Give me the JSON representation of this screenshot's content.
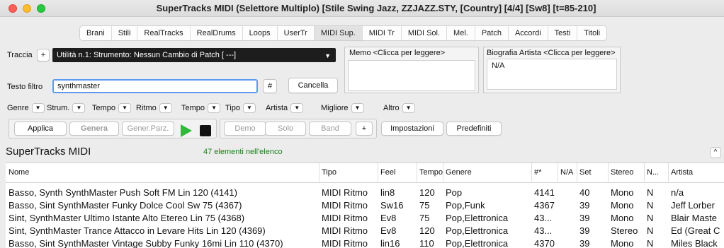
{
  "window": {
    "title": "SuperTracks MIDI  (Selettore Multiplo)  [Stile Swing Jazz, ZZJAZZ.STY,  [Country] [4/4] [Sw8] [t=85-210]"
  },
  "tabs": [
    {
      "label": "Brani"
    },
    {
      "label": "Stili"
    },
    {
      "label": "RealTracks"
    },
    {
      "label": "RealDrums"
    },
    {
      "label": "Loops"
    },
    {
      "label": "UserTr"
    },
    {
      "label": "MIDI Sup."
    },
    {
      "label": "MIDI Tr"
    },
    {
      "label": "MIDI Sol."
    },
    {
      "label": "Mel."
    },
    {
      "label": "Patch"
    },
    {
      "label": "Accordi"
    },
    {
      "label": "Testi"
    },
    {
      "label": "Titoli"
    }
  ],
  "active_tab": "MIDI Sup.",
  "track": {
    "label": "Traccia",
    "add_label": "+",
    "selected": "Utilità n.1: Strumento: Nessun Cambio di Patch [ ---]"
  },
  "memo": {
    "label": "Memo  <Clicca per leggere>",
    "content": ""
  },
  "bio": {
    "label": "Biografia Artista <Clicca per leggere>",
    "content": "N/A"
  },
  "filter": {
    "label": "Testo filtro",
    "value": "synthmaster",
    "hash_label": "#",
    "cancel_label": "Cancella"
  },
  "dropdowns": [
    {
      "label": "Genre"
    },
    {
      "label": "Strum."
    },
    {
      "label": "Tempo"
    },
    {
      "label": "Ritmo"
    },
    {
      "label": "Tempo"
    },
    {
      "label": "Tipo"
    },
    {
      "label": "Artista"
    },
    {
      "label": "Migliore"
    },
    {
      "label": "Altro"
    }
  ],
  "actions": {
    "apply": "Applica",
    "generate": "Genera",
    "generate_partial": "Gener.Parz.",
    "demo": "Demo",
    "solo": "Solo",
    "band": "Band",
    "plus": "+",
    "settings": "Impostazioni",
    "defaults": "Predefiniti"
  },
  "list": {
    "title": "SuperTracks MIDI",
    "count": "47 elementi nell'elenco",
    "collapse_icon": "^",
    "columns": [
      "Nome",
      "Tipo",
      "Feel",
      "Tempo",
      "Genere",
      "#*",
      "N/A",
      "Set",
      "Stereo",
      "N...",
      "Artista"
    ],
    "rows": [
      [
        "Basso, Synth SynthMaster Push Soft FM Lin 120  (4141)",
        "MIDI Ritmo",
        "lin8",
        "120",
        "Pop",
        "4141",
        "",
        "40",
        "Mono",
        "N",
        "n/a"
      ],
      [
        "Basso, Sint SynthMaster Funky Dolce Cool Sw 75  (4367)",
        "MIDI Ritmo",
        "Sw16",
        "75",
        "Pop,Funk",
        "4367",
        "",
        "39",
        "Mono",
        "N",
        "Jeff Lorber"
      ],
      [
        "Sint, SynthMaster Ultimo Istante Alto Etereo Lin 75  (4368)",
        "MIDI Ritmo",
        "Ev8",
        "75",
        "Pop,Elettronica",
        "43...",
        "",
        "39",
        "Mono",
        "N",
        "Blair Maste"
      ],
      [
        "Sint,  SynthMaster Trance Attacco in Levare Hits Lin 120  (4369)",
        "MIDI Ritmo",
        "Ev8",
        "120",
        "Pop,Elettronica",
        "43...",
        "",
        "39",
        "Stereo",
        "N",
        "Ed (Great C"
      ],
      [
        "Basso, Sint SynthMaster Vintage Subby Funky 16mi Lin 110  (4370)",
        "MIDI Ritmo",
        "lin16",
        "110",
        "Pop,Elettronica",
        "4370",
        "",
        "39",
        "Mono",
        "N",
        "Miles Black"
      ]
    ]
  }
}
